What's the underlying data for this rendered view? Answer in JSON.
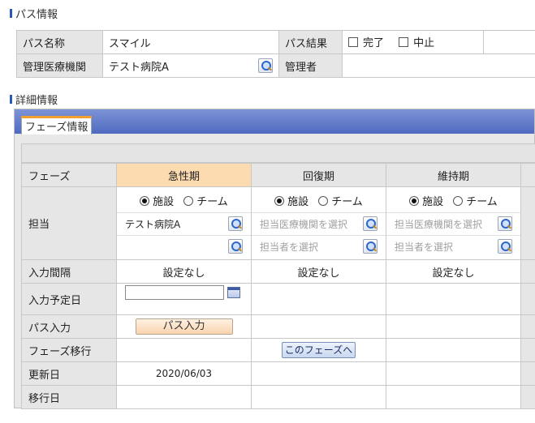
{
  "bus_info": {
    "section_title": "パス情報",
    "name_label": "パス名称",
    "name_value": "スマイル",
    "result_label": "パス結果",
    "result_options": [
      "完了",
      "中止"
    ],
    "facility_label": "管理医療機関",
    "facility_value": "テスト病院A",
    "manager_label": "管理者",
    "manager_value": ""
  },
  "detail": {
    "section_title": "詳細情報",
    "tab_label": "フェーズ情報",
    "row_labels": {
      "phase": "フェーズ",
      "assignee": "担当",
      "interval": "入力間隔",
      "scheduled": "入力予定日",
      "bus_input": "パス入力",
      "transition": "フェーズ移行",
      "updated": "更新日",
      "moved": "移行日"
    },
    "radio_facility": "施設",
    "radio_team": "チーム",
    "phases": [
      {
        "name": "急性期",
        "active": true,
        "facility": "テスト病院A",
        "staff": "",
        "interval": "設定なし",
        "bus_input_button": "パス入力",
        "updated": "2020/06/03"
      },
      {
        "name": "回復期",
        "active": false,
        "facility_placeholder": "担当医療機関を選択",
        "staff_placeholder": "担当者を選択",
        "interval": "設定なし",
        "transition_button": "このフェーズへ"
      },
      {
        "name": "維持期",
        "active": false,
        "facility_placeholder": "担当医療機関を選択",
        "staff_placeholder": "担当者を選択",
        "interval": "設定なし"
      }
    ]
  },
  "icons": {
    "search": "magnifier-icon",
    "calendar": "calendar-icon"
  },
  "colors": {
    "active_phase": "#fddbb0",
    "header_blue": "#4f6ac0",
    "section_bar": "#2a58b8"
  }
}
